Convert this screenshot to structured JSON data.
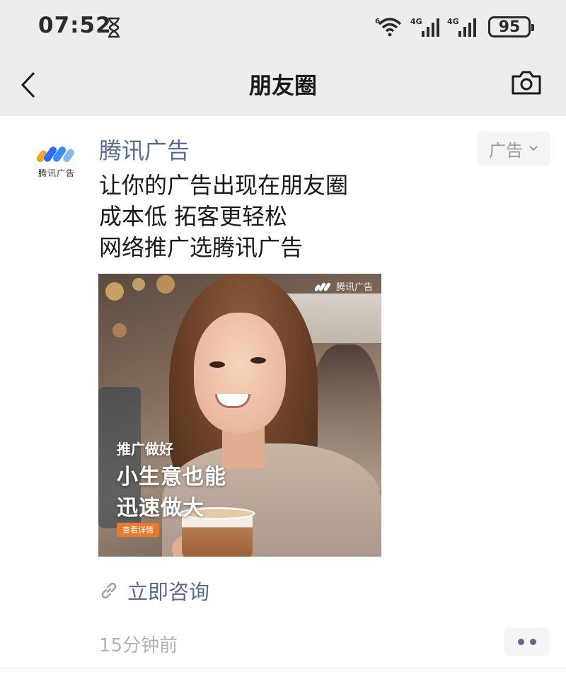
{
  "status_bar": {
    "time": "07:52",
    "network_label": "4G",
    "network_label_2": "4G",
    "wifi_label": "6",
    "battery": "95"
  },
  "nav": {
    "title": "朋友圈",
    "icons": {
      "back": "chevron-left-icon",
      "camera": "camera-icon"
    }
  },
  "post": {
    "author": "腾讯广告",
    "avatar_text": "腾讯广告",
    "ad_tag": "广告",
    "lines": [
      "让你的广告出现在朋友圈",
      "成本低 拓客更轻松",
      "网络推广选腾讯广告"
    ],
    "image": {
      "logo_text": "腾讯广告",
      "tagline_small": "推广做好",
      "tagline_line1": "小生意也能",
      "tagline_line2": "迅速做大",
      "button": "查看详情"
    },
    "link_label": "立即咨询",
    "timestamp": "15分钟前"
  },
  "colors": {
    "link": "#576b95",
    "nav_bg": "#ededed",
    "ad_button": "#e87a2c"
  }
}
